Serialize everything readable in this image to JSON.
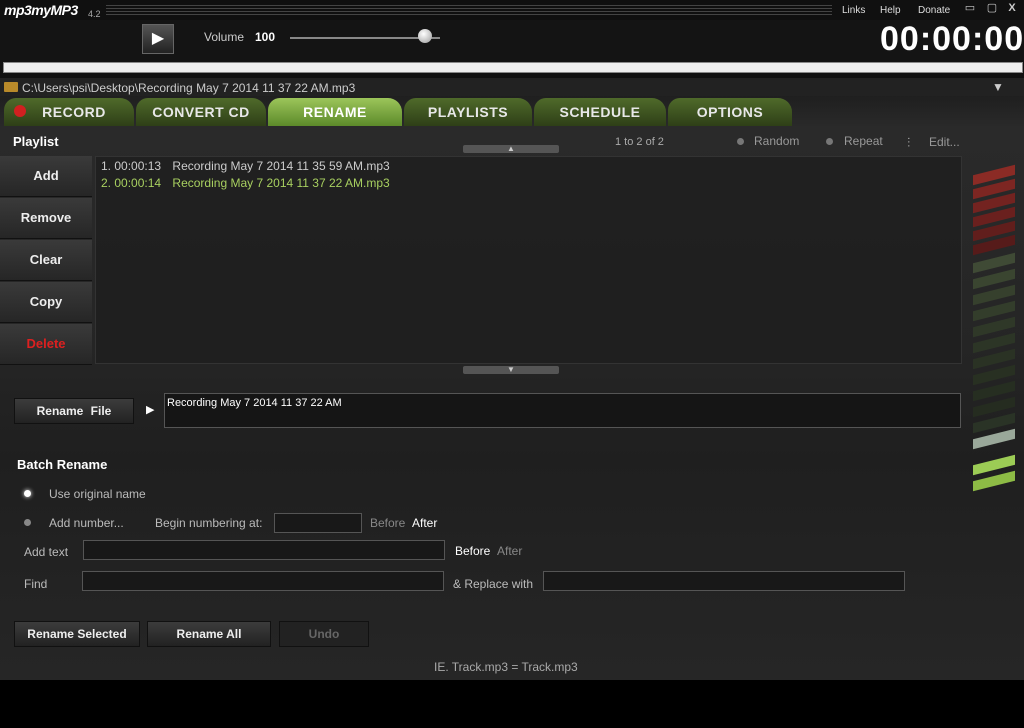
{
  "app": {
    "name": "mp3myMP3",
    "version": "4.2"
  },
  "toplinks": {
    "links": "Links",
    "help": "Help",
    "donate": "Donate",
    "close": "X"
  },
  "transport": {
    "volume_label": "Volume",
    "volume_value": "100",
    "volume_level": 0.9,
    "timer": "00:00:00"
  },
  "path": "C:\\Users\\psi\\Desktop\\Recording May 7 2014 11 37 22 AM.mp3",
  "tabs": [
    {
      "label": "RECORD"
    },
    {
      "label": "CONVERT CD"
    },
    {
      "label": "RENAME"
    },
    {
      "label": "PLAYLISTS"
    },
    {
      "label": "SCHEDULE"
    },
    {
      "label": "OPTIONS"
    }
  ],
  "active_tab": "RENAME",
  "playlist": {
    "title": "Playlist",
    "count": "1 to 2 of 2",
    "random": "Random",
    "repeat": "Repeat",
    "edit": "Edit...",
    "buttons": {
      "add": "Add",
      "remove": "Remove",
      "clear": "Clear",
      "copy": "Copy",
      "delete": "Delete"
    },
    "items": [
      {
        "num": "1.",
        "time": "00:00:13",
        "name": "Recording May 7 2014 11 35 59 AM.mp3",
        "color": "#cccccc"
      },
      {
        "num": "2.",
        "time": "00:00:14",
        "name": "Recording May 7 2014 11 37 22 AM.mp3",
        "color": "#a8d060"
      }
    ]
  },
  "rename": {
    "button_a": "Rename",
    "button_b": "File",
    "value": "Recording May 7 2014 11 37 22 AM"
  },
  "batch": {
    "title": "Batch Rename",
    "use_original": "Use original name",
    "add_number": "Add number...",
    "begin_numbering": "Begin numbering at:",
    "before": "Before",
    "after": "After",
    "add_text": "Add text",
    "find": "Find",
    "replace_with": "& Replace with",
    "rename_selected": "Rename Selected",
    "rename_all": "Rename All",
    "undo": "Undo",
    "example": "IE.   Track.mp3 = Track.mp3"
  },
  "colors": {
    "accent_green": "#9cc55a",
    "record_red": "#d12020",
    "delete_red": "#dd2020"
  }
}
